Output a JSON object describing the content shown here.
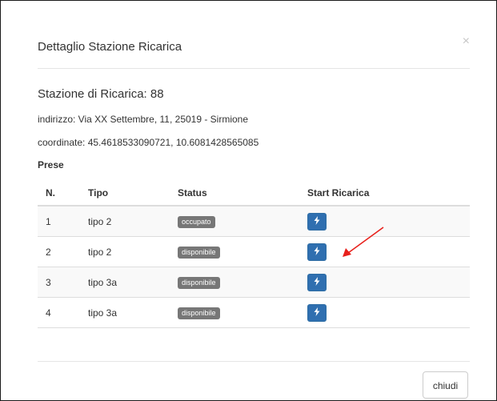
{
  "modal": {
    "title": "Dettaglio Stazione Ricarica",
    "close_glyph": "×"
  },
  "station": {
    "name": "Stazione di Ricarica: 88",
    "address": "indirizzo: Via XX Settembre, 11, 25019 - Sirmione",
    "coordinates": "coordinate: 45.4618533090721, 10.6081428565085"
  },
  "prese": {
    "heading": "Prese",
    "headers": {
      "n": "N.",
      "tipo": "Tipo",
      "status": "Status",
      "start": "Start Ricarica"
    },
    "rows": [
      {
        "n": "1",
        "tipo": "tipo 2",
        "status": "occupato"
      },
      {
        "n": "2",
        "tipo": "tipo 2",
        "status": "disponibile"
      },
      {
        "n": "3",
        "tipo": "tipo 3a",
        "status": "disponibile"
      },
      {
        "n": "4",
        "tipo": "tipo 3a",
        "status": "disponibile"
      }
    ],
    "start_icon": "lightning-bolt-icon"
  },
  "annotation": {
    "arrow_color": "#e8201b",
    "arrow_target": "start-button-row-2"
  },
  "footer": {
    "close_label": "chiudi"
  },
  "colors": {
    "badge": "#777777",
    "start_button": "#2f6fb0"
  }
}
